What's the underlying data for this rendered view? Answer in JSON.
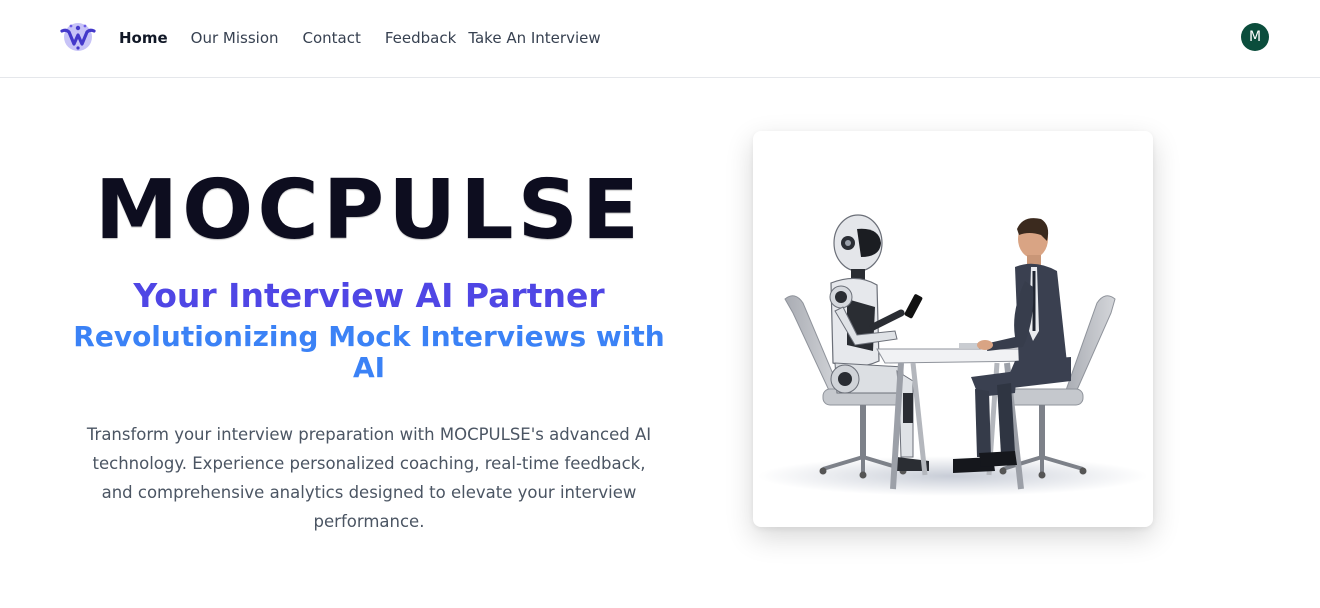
{
  "nav": {
    "logo_icon": "mocpulse-logo-icon",
    "links": [
      {
        "label": "Home",
        "active": true
      },
      {
        "label": "Our Mission",
        "active": false
      },
      {
        "label": "Contact",
        "active": false
      },
      {
        "label": "Feedback",
        "active": false
      },
      {
        "label": "Take An Interview",
        "active": false
      }
    ],
    "avatar_initial": "M",
    "avatar_color": "#0b4d3c"
  },
  "hero": {
    "title": "MOCPULSE",
    "tagline": "Your Interview AI Partner",
    "subtagline": "Revolutionizing Mock Interviews with AI",
    "description": "Transform your interview preparation with MOCPULSE's advanced AI technology. Experience personalized coaching, real-time feedback, and comprehensive analytics designed to elevate your interview performance.",
    "image": "robot-interview-illustration"
  },
  "colors": {
    "title": "#0d0d1f",
    "tagline": "#4f46e5",
    "subtagline": "#3b82f6",
    "text": "#4b5563"
  }
}
